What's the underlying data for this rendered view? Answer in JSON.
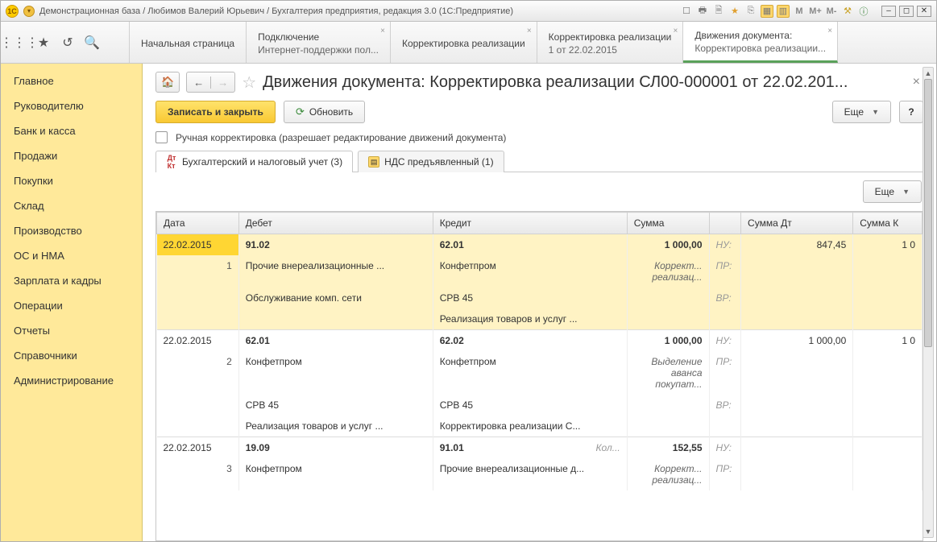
{
  "titlebar": {
    "title": "Демонстрационная база / Любимов Валерий Юрьевич / Бухгалтерия предприятия, редакция 3.0  (1С:Предприятие)",
    "m1": "M",
    "m2": "M+",
    "m3": "M-"
  },
  "tabs": [
    {
      "line1": "Начальная страница",
      "line2": "",
      "closable": false
    },
    {
      "line1": "Подключение",
      "line2": "Интернет-поддержки пол...",
      "closable": true
    },
    {
      "line1": "Корректировка реализации",
      "line2": "",
      "closable": true
    },
    {
      "line1": "Корректировка реализации",
      "line2": "1 от 22.02.2015",
      "closable": true
    },
    {
      "line1": "Движения документа:",
      "line2": "Корректировка реализации...",
      "closable": true,
      "active": true
    }
  ],
  "sidebar": {
    "items": [
      "Главное",
      "Руководителю",
      "Банк и касса",
      "Продажи",
      "Покупки",
      "Склад",
      "Производство",
      "ОС и НМА",
      "Зарплата и кадры",
      "Операции",
      "Отчеты",
      "Справочники",
      "Администрирование"
    ]
  },
  "page": {
    "title": "Движения документа: Корректировка реализации СЛ00-000001 от 22.02.201...",
    "save_close": "Записать и закрыть",
    "refresh": "Обновить",
    "more": "Еще",
    "help": "?",
    "manual_edit": "Ручная корректировка (разрешает редактирование движений документа)",
    "inner_tabs": {
      "buh": "Бухгалтерский и налоговый учет (3)",
      "nds": "НДС предъявленный (1)"
    }
  },
  "grid": {
    "headers": [
      "Дата",
      "Дебет",
      "Кредит",
      "Сумма",
      "",
      "Сумма Дт",
      "Сумма К"
    ],
    "entries": [
      {
        "selected": true,
        "idx": "1",
        "date": "22.02.2015",
        "debit": [
          "91.02",
          "Прочие внереализационные ...",
          "Обслуживание комп. сети",
          ""
        ],
        "credit": [
          "62.01",
          "Конфетпром",
          "СРВ 45",
          "Реализация товаров и услуг ..."
        ],
        "sum": [
          "1 000,00",
          "Коррект... реализац...",
          "",
          ""
        ],
        "lbl": [
          "НУ:",
          "ПР:",
          "ВР:",
          ""
        ],
        "sumdt": [
          "847,45",
          "",
          "",
          ""
        ],
        "sumk": [
          "1 0",
          "",
          "",
          ""
        ]
      },
      {
        "selected": false,
        "idx": "2",
        "date": "22.02.2015",
        "debit": [
          "62.01",
          "Конфетпром",
          "СРВ 45",
          "Реализация товаров и услуг ..."
        ],
        "credit": [
          "62.02",
          "Конфетпром",
          "СРВ 45",
          "Корректировка реализации С..."
        ],
        "sum": [
          "1 000,00",
          "Выделение аванса покупат...",
          "",
          ""
        ],
        "lbl": [
          "НУ:",
          "ПР:",
          "ВР:",
          ""
        ],
        "sumdt": [
          "1 000,00",
          "",
          "",
          ""
        ],
        "sumk": [
          "1 0",
          "",
          "",
          ""
        ]
      },
      {
        "selected": false,
        "idx": "3",
        "date": "22.02.2015",
        "debit": [
          "19.09",
          "Конфетпром",
          "",
          ""
        ],
        "credit": [
          "91.01",
          "Прочие внереализационные д...",
          "",
          ""
        ],
        "sum": [
          "152,55",
          "Коррект... реализац...",
          "",
          ""
        ],
        "lbl": [
          "НУ:",
          "ПР:",
          "",
          ""
        ],
        "sumdt": [
          "",
          "",
          "",
          ""
        ],
        "sumk": [
          "",
          "",
          "",
          ""
        ],
        "kol": "Кол..."
      }
    ]
  }
}
